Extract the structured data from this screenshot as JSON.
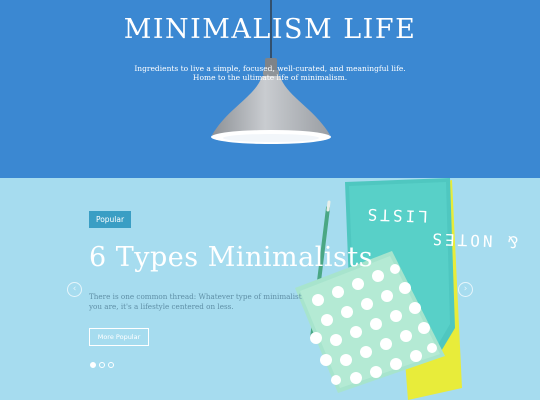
{
  "hero": {
    "title": "MINIMALISM LIFE",
    "tagline_line1": "Ingredients to live a simple, focused, well-curated, and meaningful life.",
    "tagline_line2": "Home to the ultimate life of minimalism.",
    "background_color": "#3b88d2",
    "image": "pendant-lamp"
  },
  "slider": {
    "background_color": "#a6dcef",
    "badge_label": "Popular",
    "heading": "6 Types Minimalists",
    "description_line1": "There is one common thread: Whatever type of minimalist",
    "description_line2": "you are, it's a lifestyle centered on less.",
    "button_label": "More Popular",
    "notebook_text_line1": "LISTS",
    "notebook_text_line2": "& NOTES",
    "prev_icon": "chevron-left-icon",
    "next_icon": "chevron-right-icon",
    "prev_glyph": "‹",
    "next_glyph": "›",
    "total_slides": 3,
    "active_slide": 1,
    "accent_color": "#3a9ec4"
  }
}
